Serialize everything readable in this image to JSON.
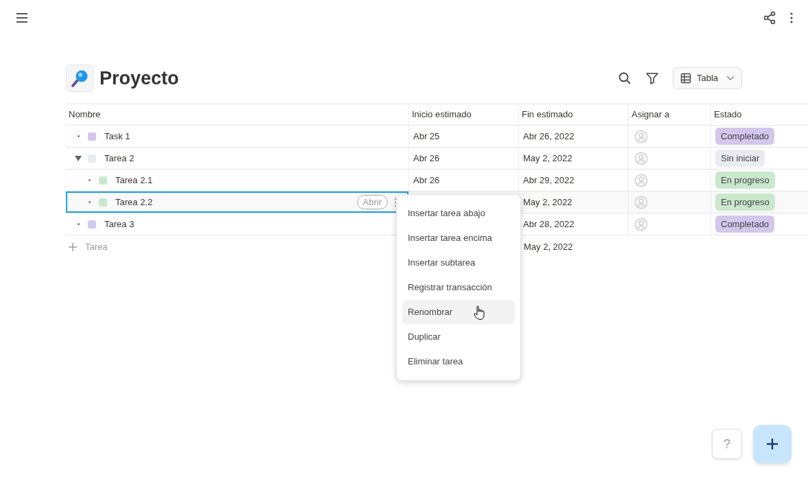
{
  "page": {
    "title": "Proyecto"
  },
  "toolbar": {
    "view_label": "Tabla"
  },
  "table": {
    "columns": [
      "Nombre",
      "Inicio estimado",
      "Fin estimado",
      "Asignar a",
      "Estado"
    ],
    "rows": [
      {
        "name": "Task 1",
        "color": "#d3c7ec",
        "start": "Abr 25",
        "end": "Abr 26, 2022",
        "status": "Completado",
        "selected": false
      },
      {
        "name": "Tarea 2",
        "color": "#e8ecf1",
        "start": "Abr 26",
        "end": "May 2, 2022",
        "status": "Sin iniciar",
        "selected": false,
        "expanded": true,
        "children": [
          {
            "name": "Tarea 2.1",
            "color": "#c9e8cc",
            "start": "Abr 26",
            "end": "Abr 29, 2022",
            "status": "En progreso",
            "selected": false
          },
          {
            "name": "Tarea 2.2",
            "color": "#c9e8cc",
            "end": "May 2, 2022",
            "status": "En progreso",
            "selected": true,
            "open_label": "Abrir"
          }
        ]
      },
      {
        "name": "Tarea 3",
        "color": "#d3c7ec",
        "end": "Abr 28, 2022",
        "status": "Completado",
        "selected": false
      }
    ],
    "add_row": {
      "label": "Tarea",
      "end": "May 2, 2022"
    }
  },
  "context_menu": [
    {
      "label": "Insertar tarea abajo",
      "hovered": false
    },
    {
      "label": "Insertar tarea encima",
      "hovered": false
    },
    {
      "label": "Insertar subtarea",
      "hovered": false
    },
    {
      "label": "Registrar transacción",
      "hovered": false
    },
    {
      "label": "Renombrar",
      "hovered": true
    },
    {
      "label": "Duplicar",
      "hovered": false
    },
    {
      "label": "Eliminar tarea",
      "hovered": false
    }
  ],
  "help_button": "?"
}
